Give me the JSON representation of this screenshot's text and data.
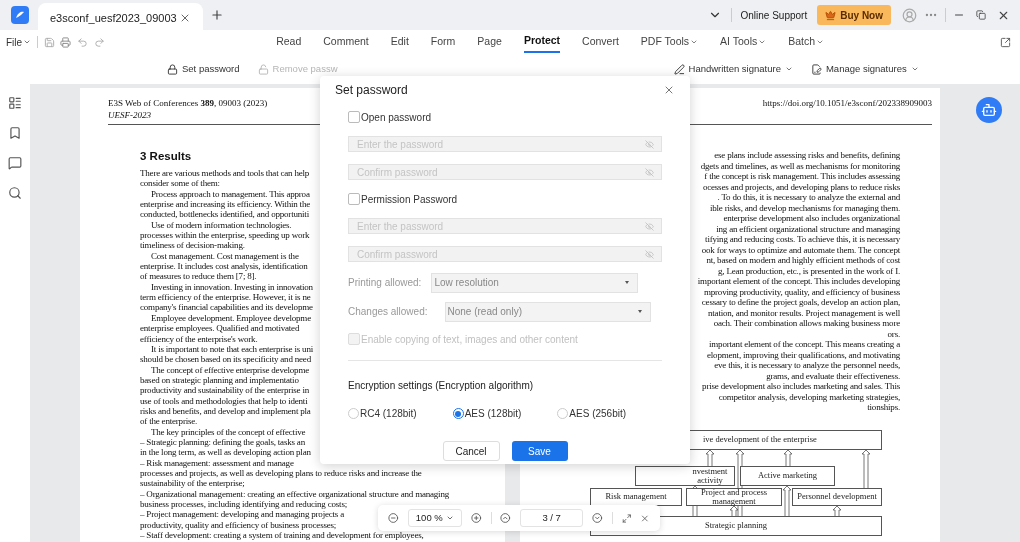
{
  "title_bar": {
    "tab_title": "e3sconf_uesf2023_09003",
    "online_support": "Online Support",
    "buy_now": "Buy Now"
  },
  "menu": {
    "file": "File",
    "tabs": [
      {
        "label": "Read",
        "selected": false,
        "dropdown": false
      },
      {
        "label": "Comment",
        "selected": false,
        "dropdown": false
      },
      {
        "label": "Edit",
        "selected": false,
        "dropdown": false
      },
      {
        "label": "Form",
        "selected": false,
        "dropdown": false
      },
      {
        "label": "Page",
        "selected": false,
        "dropdown": false
      },
      {
        "label": "Protect",
        "selected": true,
        "dropdown": false
      },
      {
        "label": "Convert",
        "selected": false,
        "dropdown": false
      },
      {
        "label": "PDF Tools",
        "selected": false,
        "dropdown": true
      },
      {
        "label": "AI Tools",
        "selected": false,
        "dropdown": true
      },
      {
        "label": "Batch",
        "selected": false,
        "dropdown": true
      }
    ]
  },
  "toolbar": [
    {
      "kind": "lock",
      "label": "Set password",
      "disabled": false,
      "dropdown": false
    },
    {
      "kind": "unlock",
      "label": "Remove passw",
      "disabled": true,
      "dropdown": false
    },
    {
      "kind": "pen",
      "label": "Handwritten signature",
      "disabled": false,
      "dropdown": true
    },
    {
      "kind": "signatures",
      "label": "Manage signatures",
      "disabled": false,
      "dropdown": true
    }
  ],
  "left_page": {
    "journal": "E3S Web of Conferences **389**, 09003 (2023)",
    "conference": "UESF-2023",
    "lines": [
      {
        "kind": "heading",
        "text": "3 Results"
      },
      {
        "kind": "line",
        "text": "There are various methods and tools that can help"
      },
      {
        "kind": "line",
        "text": "consider some of them:"
      },
      {
        "kind": "indent",
        "text": "Process approach to management. This approa"
      },
      {
        "kind": "line",
        "text": "enterprise and increasing its efficiency. Within the"
      },
      {
        "kind": "line",
        "text": "conducted, bottlenecks identified, and opportuniti"
      },
      {
        "kind": "indent",
        "text": "Use of modern information technologies."
      },
      {
        "kind": "line",
        "text": "processes within the enterprise, speeding up work"
      },
      {
        "kind": "line",
        "text": "timeliness of decision-making."
      },
      {
        "kind": "indent",
        "text": "Cost management. Cost management is the"
      },
      {
        "kind": "line",
        "text": "enterprise. It includes cost analysis, identification"
      },
      {
        "kind": "line",
        "text": "of measures to reduce them [7; 8]."
      },
      {
        "kind": "indent",
        "text": "Investing in innovation. Investing in innovation"
      },
      {
        "kind": "line",
        "text": "term efficiency of the enterprise. However, it is ne"
      },
      {
        "kind": "line",
        "text": "company's financial capabilities and its developme"
      },
      {
        "kind": "indent",
        "text": "Employee development. Employee developme"
      },
      {
        "kind": "line",
        "text": "enterprise employees. Qualified and motivated"
      },
      {
        "kind": "line",
        "text": "efficiency of the enterprise's work."
      },
      {
        "kind": "indent",
        "text": "It is important to note that each enterprise is uni"
      },
      {
        "kind": "line",
        "text": "should be chosen based on its specificity and need"
      },
      {
        "kind": "indent",
        "text": "The concept of effective enterprise developme"
      },
      {
        "kind": "line",
        "text": "based on strategic planning and implementatio"
      },
      {
        "kind": "line",
        "text": "productivity and sustainability of the enterprise in"
      },
      {
        "kind": "line",
        "text": "use of tools and methodologies that help to identi"
      },
      {
        "kind": "line",
        "text": "risks and benefits, and develop and implement pla"
      },
      {
        "kind": "line",
        "text": "of the enterprise."
      },
      {
        "kind": "indent",
        "text": "The key principles of the concept of effective"
      },
      {
        "kind": "line",
        "text": "–  Strategic planning: defining the goals, tasks an"
      },
      {
        "kind": "line",
        "text": "in the long term, as well as developing action plan"
      },
      {
        "kind": "line",
        "text": "–  Risk management: assessment and manage"
      },
      {
        "kind": "line",
        "text": "processes and projects, as well as developing plans to reduce risks and increase the"
      },
      {
        "kind": "line",
        "text": "sustainability of the enterprise;"
      },
      {
        "kind": "line",
        "text": "–  Organizational management: creating an effective organizational structure and managing"
      },
      {
        "kind": "line",
        "text": "business processes, including identifying and reducing costs;"
      },
      {
        "kind": "line",
        "text": "–  Project management: developing and managing projects a"
      },
      {
        "kind": "line",
        "text": "productivity, quality and efficiency of business processes;"
      },
      {
        "kind": "line",
        "text": "–  Staff development: creating a system of training and development for employees,"
      }
    ]
  },
  "right_page": {
    "doi": "https://doi.org/10.1051/e3sconf/202338909003",
    "lines": [
      "ese plans include assessing risks and benefits, defining",
      "dgets and timelines, as well as mechanisms for monitoring",
      "f the concept is risk management. This includes assessing",
      "ocesses and projects, and developing plans to reduce risks",
      ". To do this, it is necessary to analyze the external and",
      "ible risks, and develop mechanisms for managing them.",
      "enterprise development also includes organizational",
      "ing an efficient organizational structure and managing",
      "tifying and reducing costs. To achieve this, it is necessary",
      "ook for ways to optimize and automate them. The concept",
      "nt, based on modern and highly efficient methods of cost",
      "g, Lean production, etc., is presented in the work of I.",
      "important element of the concept. This includes developing",
      "mproving productivity, quality, and efficiency of business",
      "cessary to define the project goals, develop an action plan,",
      "ntation, and monitor results. Project management is well",
      "oach. Their combination allows making business more",
      "ors.",
      "important element of the concept. This means creating a",
      "elopment, improving their qualifications, and motivating",
      "eve this, it is necessary to analyze the personnel needs,",
      "grams, and evaluate their effectiveness.",
      "prise development also includes marketing and sales. This",
      "competitor analysis, developing marketing strategies,",
      "tionships."
    ],
    "diagram": {
      "top": "ive development of the enterprise",
      "investment": "nvestment activity",
      "marketing": "Active marketing",
      "risk": "Risk management",
      "project": "Project and process management",
      "personnel": "Personnel development",
      "strategic": "Strategic planning"
    }
  },
  "dialog": {
    "title": "Set password",
    "open_password": {
      "label": "Open password",
      "checked": false,
      "fields": [
        {
          "placeholder": "Enter the password",
          "disabled": true
        },
        {
          "placeholder": "Confirm password",
          "disabled": true
        }
      ]
    },
    "permission_password": {
      "label": "Permission Password",
      "checked": false,
      "fields": [
        {
          "placeholder": "Enter the password",
          "disabled": true
        },
        {
          "placeholder": "Confirm password",
          "disabled": true
        }
      ]
    },
    "selects": [
      {
        "label": "Printing allowed:",
        "value": "Low resolution",
        "disabled": true
      },
      {
        "label": "Changes allowed:",
        "value": "None (read only)",
        "disabled": true
      }
    ],
    "copy_option": {
      "label": "Enable copying of text, images and other content",
      "checked": false,
      "disabled": true
    },
    "encryption_title": "Encryption settings (Encryption algorithm)",
    "algorithms": [
      {
        "label": "RC4 (128bit)",
        "selected": false
      },
      {
        "label": "AES (128bit)",
        "selected": true
      },
      {
        "label": "AES (256bit)",
        "selected": false
      }
    ],
    "cancel": "Cancel",
    "save": "Save"
  },
  "zoom_bar": {
    "zoom": "100 %",
    "page": "3 / 7"
  }
}
